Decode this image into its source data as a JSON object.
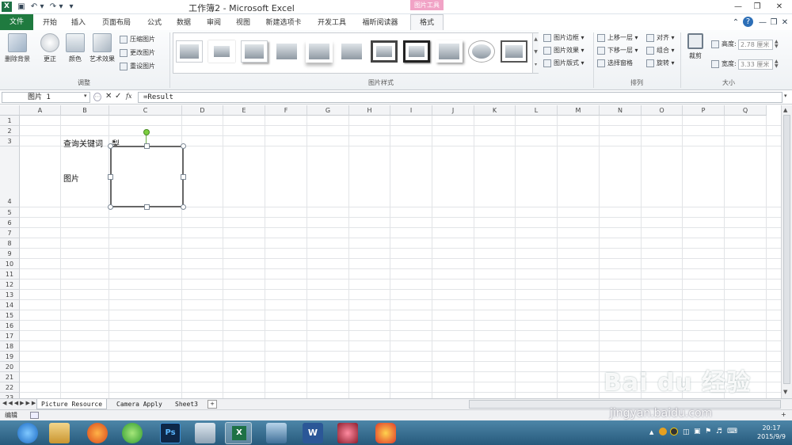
{
  "window": {
    "title": "工作簿2 - Microsoft Excel",
    "context_tab": "图片工具"
  },
  "tabs": [
    {
      "label": "文件"
    },
    {
      "label": "开始"
    },
    {
      "label": "插入"
    },
    {
      "label": "页面布局"
    },
    {
      "label": "公式"
    },
    {
      "label": "数据"
    },
    {
      "label": "审阅"
    },
    {
      "label": "视图"
    },
    {
      "label": "新建选项卡"
    },
    {
      "label": "开发工具"
    },
    {
      "label": "福昕阅读器"
    },
    {
      "label": "格式"
    }
  ],
  "ribbon": {
    "adjust": {
      "remove_bg": "删除背景",
      "corrections": "更正",
      "color": "颜色",
      "artistic": "艺术效果",
      "compress": "压缩图片",
      "change": "更改图片",
      "reset": "重设图片",
      "group_label": "调整"
    },
    "styles": {
      "border": "图片边框",
      "effects": "图片效果",
      "layout": "图片版式",
      "group_label": "图片样式"
    },
    "arrange": {
      "bring_forward": "上移一层",
      "send_backward": "下移一层",
      "selection_pane": "选择窗格",
      "align": "对齐",
      "group": "组合",
      "rotate": "旋转",
      "group_label": "排列"
    },
    "size": {
      "crop": "裁剪",
      "height_label": "高度:",
      "height_value": "2.78 厘米",
      "width_label": "宽度:",
      "width_value": "3.33 厘米",
      "group_label": "大小"
    }
  },
  "formula_bar": {
    "name_box": "图片 1",
    "formula": "=Result",
    "fx": "fx"
  },
  "columns": [
    "A",
    "B",
    "C",
    "D",
    "E",
    "F",
    "G",
    "H",
    "I",
    "J",
    "K",
    "L",
    "M",
    "N",
    "O",
    "P",
    "Q"
  ],
  "rows": [
    "1",
    "2",
    "3",
    "4",
    "5",
    "6",
    "7",
    "8",
    "9",
    "10",
    "11",
    "12",
    "13",
    "14",
    "15",
    "16",
    "17",
    "18",
    "19",
    "20",
    "21",
    "22",
    "23"
  ],
  "cells": {
    "b3": "查询关键词",
    "c3": "梨",
    "b4": "图片"
  },
  "sheets": [
    "Picture Resource",
    "Camera Apply",
    "Sheet3"
  ],
  "status": {
    "mode": "编辑"
  },
  "taskbar": {
    "time": "20:17",
    "date": "2015/9/9"
  },
  "watermark": {
    "brand": "Bai du 经验",
    "url": "jingyan.baidu.com"
  }
}
